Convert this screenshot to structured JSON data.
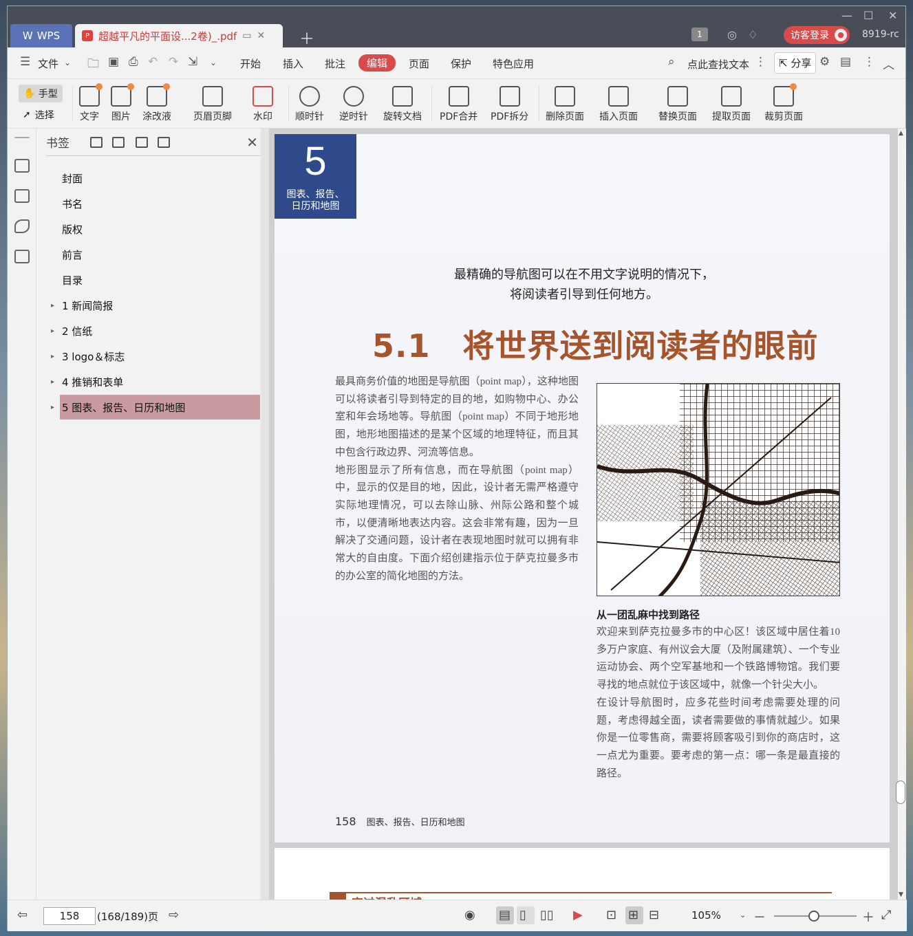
{
  "titlebar": {
    "app_tab": "WPS",
    "doc_tab": "超越平凡的平面设...2卷)_.pdf",
    "page_badge": "1",
    "login": "访客登录",
    "user_id": "8919-rc"
  },
  "menu": {
    "file": "文件",
    "items": [
      "开始",
      "插入",
      "批注",
      "编辑",
      "页面",
      "保护",
      "特色应用"
    ],
    "active": "编辑",
    "search": "点此查找文本",
    "share": "分享"
  },
  "ribbon": {
    "hand": "手型",
    "select": "选择",
    "tools": [
      "文字",
      "图片",
      "涂改液",
      "页眉页脚",
      "水印",
      "顺时针",
      "逆时针",
      "旋转文档",
      "PDF合并",
      "PDF拆分",
      "删除页面",
      "插入页面",
      "替换页面",
      "提取页面",
      "裁剪页面"
    ]
  },
  "panel": {
    "title": "书签",
    "bookmarks": [
      "封面",
      "书名",
      "版权",
      "前言",
      "目录",
      "1 新闻简报",
      "2 信纸",
      "3 logo＆标志",
      "4 推销和表单",
      "5 图表、报告、日历和地图"
    ]
  },
  "page": {
    "chapter_num": "5",
    "chapter_line1": "图表、报告、",
    "chapter_line2": "日历和地图",
    "quote_line1": "最精确的导航图可以在不用文字说明的情况下，",
    "quote_line2": "将阅读者引导到任何地方。",
    "heading": "5.1　将世界送到阅读者的眼前",
    "body1": "最具商务价值的地图是导航图（point map），这种地图可以将读者引导到特定的目的地，如购物中心、办公室和年会场地等。导航图（point map）不同于地形地图，地形地图描述的是某个区域的地理特征，而且其中包含行政边界、河流等信息。",
    "body1b": "地形图显示了所有信息，而在导航图（point map）中，显示的仅是目的地，因此，设计者无需严格遵守实际地理情况，可以去除山脉、州际公路和整个城市，以便清晰地表达内容。这会非常有趣，因为一旦解决了交通问题，设计者在表现地图时就可以拥有非常大的自由度。下面介绍创建指示位于萨克拉曼多市的办公室的简化地图的方法。",
    "caption_title": "从一团乱麻中找到路径",
    "body2": "欢迎来到萨克拉曼多市的中心区！该区域中居住着10多万户家庭、有州议会大厦（及附属建筑）、一个专业运动协会、两个空军基地和一个铁路博物馆。我们要寻找的地点就位于该区域中，就像一个针尖大小。",
    "body2b": "在设计导航图时，应多花些时间考虑需要处理的问题，考虑得越全面，读者需要做的事情就越少。如果你是一位零售商，需要将顾客吸引到你的商店时，这一点尤为重要。要考虑的第一点：哪一条是最直接的路径。",
    "page_number": "158",
    "footer_title": "图表、报告、日历和地图",
    "next_page_heading": "穿过混乱区域"
  },
  "status": {
    "current_page": "158",
    "total": "(168/189)页",
    "zoom": "105%"
  },
  "colors": {
    "accent": "#d94b4b",
    "heading": "#a5542c",
    "chapter_block": "#2e4a8a",
    "selected_bookmark": "#c99aa0"
  }
}
